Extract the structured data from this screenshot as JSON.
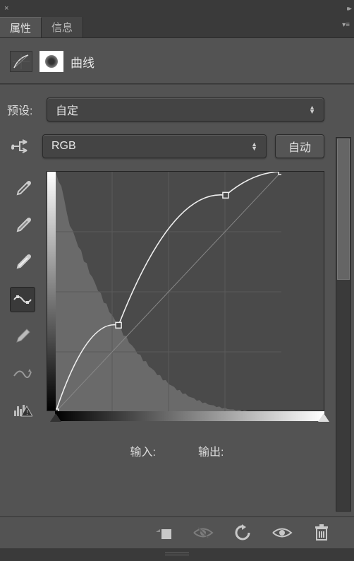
{
  "titlebar": {
    "close_glyph": "×",
    "collapse_glyph": "▸▸"
  },
  "tabs": {
    "properties": "属性",
    "info": "信息"
  },
  "header": {
    "title": "曲线"
  },
  "preset": {
    "label": "预设:",
    "value": "自定"
  },
  "channel": {
    "value": "RGB",
    "auto_label": "自动"
  },
  "io": {
    "input_label": "输入:",
    "output_label": "输出:"
  },
  "icons": {
    "curves": "curves-icon",
    "mask": "mask-icon",
    "finger": "finger-icon",
    "eyedropper_black": "eyedropper-black",
    "eyedropper_gray": "eyedropper-gray",
    "eyedropper_white": "eyedropper-white",
    "curve_tool": "curve-tool",
    "pencil": "pencil-tool",
    "smooth": "smooth-tool",
    "histogram": "histogram-warn"
  },
  "footer": {
    "clip": "clip-to-layer",
    "view_prev": "view-previous",
    "reset": "reset",
    "visibility": "toggle-visibility",
    "delete": "delete"
  },
  "chart_data": {
    "type": "line",
    "title": "曲线",
    "xlabel": "输入",
    "ylabel": "输出",
    "xlim": [
      0,
      255
    ],
    "ylim": [
      0,
      255
    ],
    "series": [
      {
        "name": "RGB",
        "points": [
          {
            "x": 0,
            "y": 0
          },
          {
            "x": 71,
            "y": 92
          },
          {
            "x": 192,
            "y": 230
          },
          {
            "x": 255,
            "y": 255
          }
        ]
      }
    ],
    "baseline": [
      {
        "x": 0,
        "y": 0
      },
      {
        "x": 255,
        "y": 255
      }
    ],
    "histogram_hint": "dark-heavy"
  }
}
